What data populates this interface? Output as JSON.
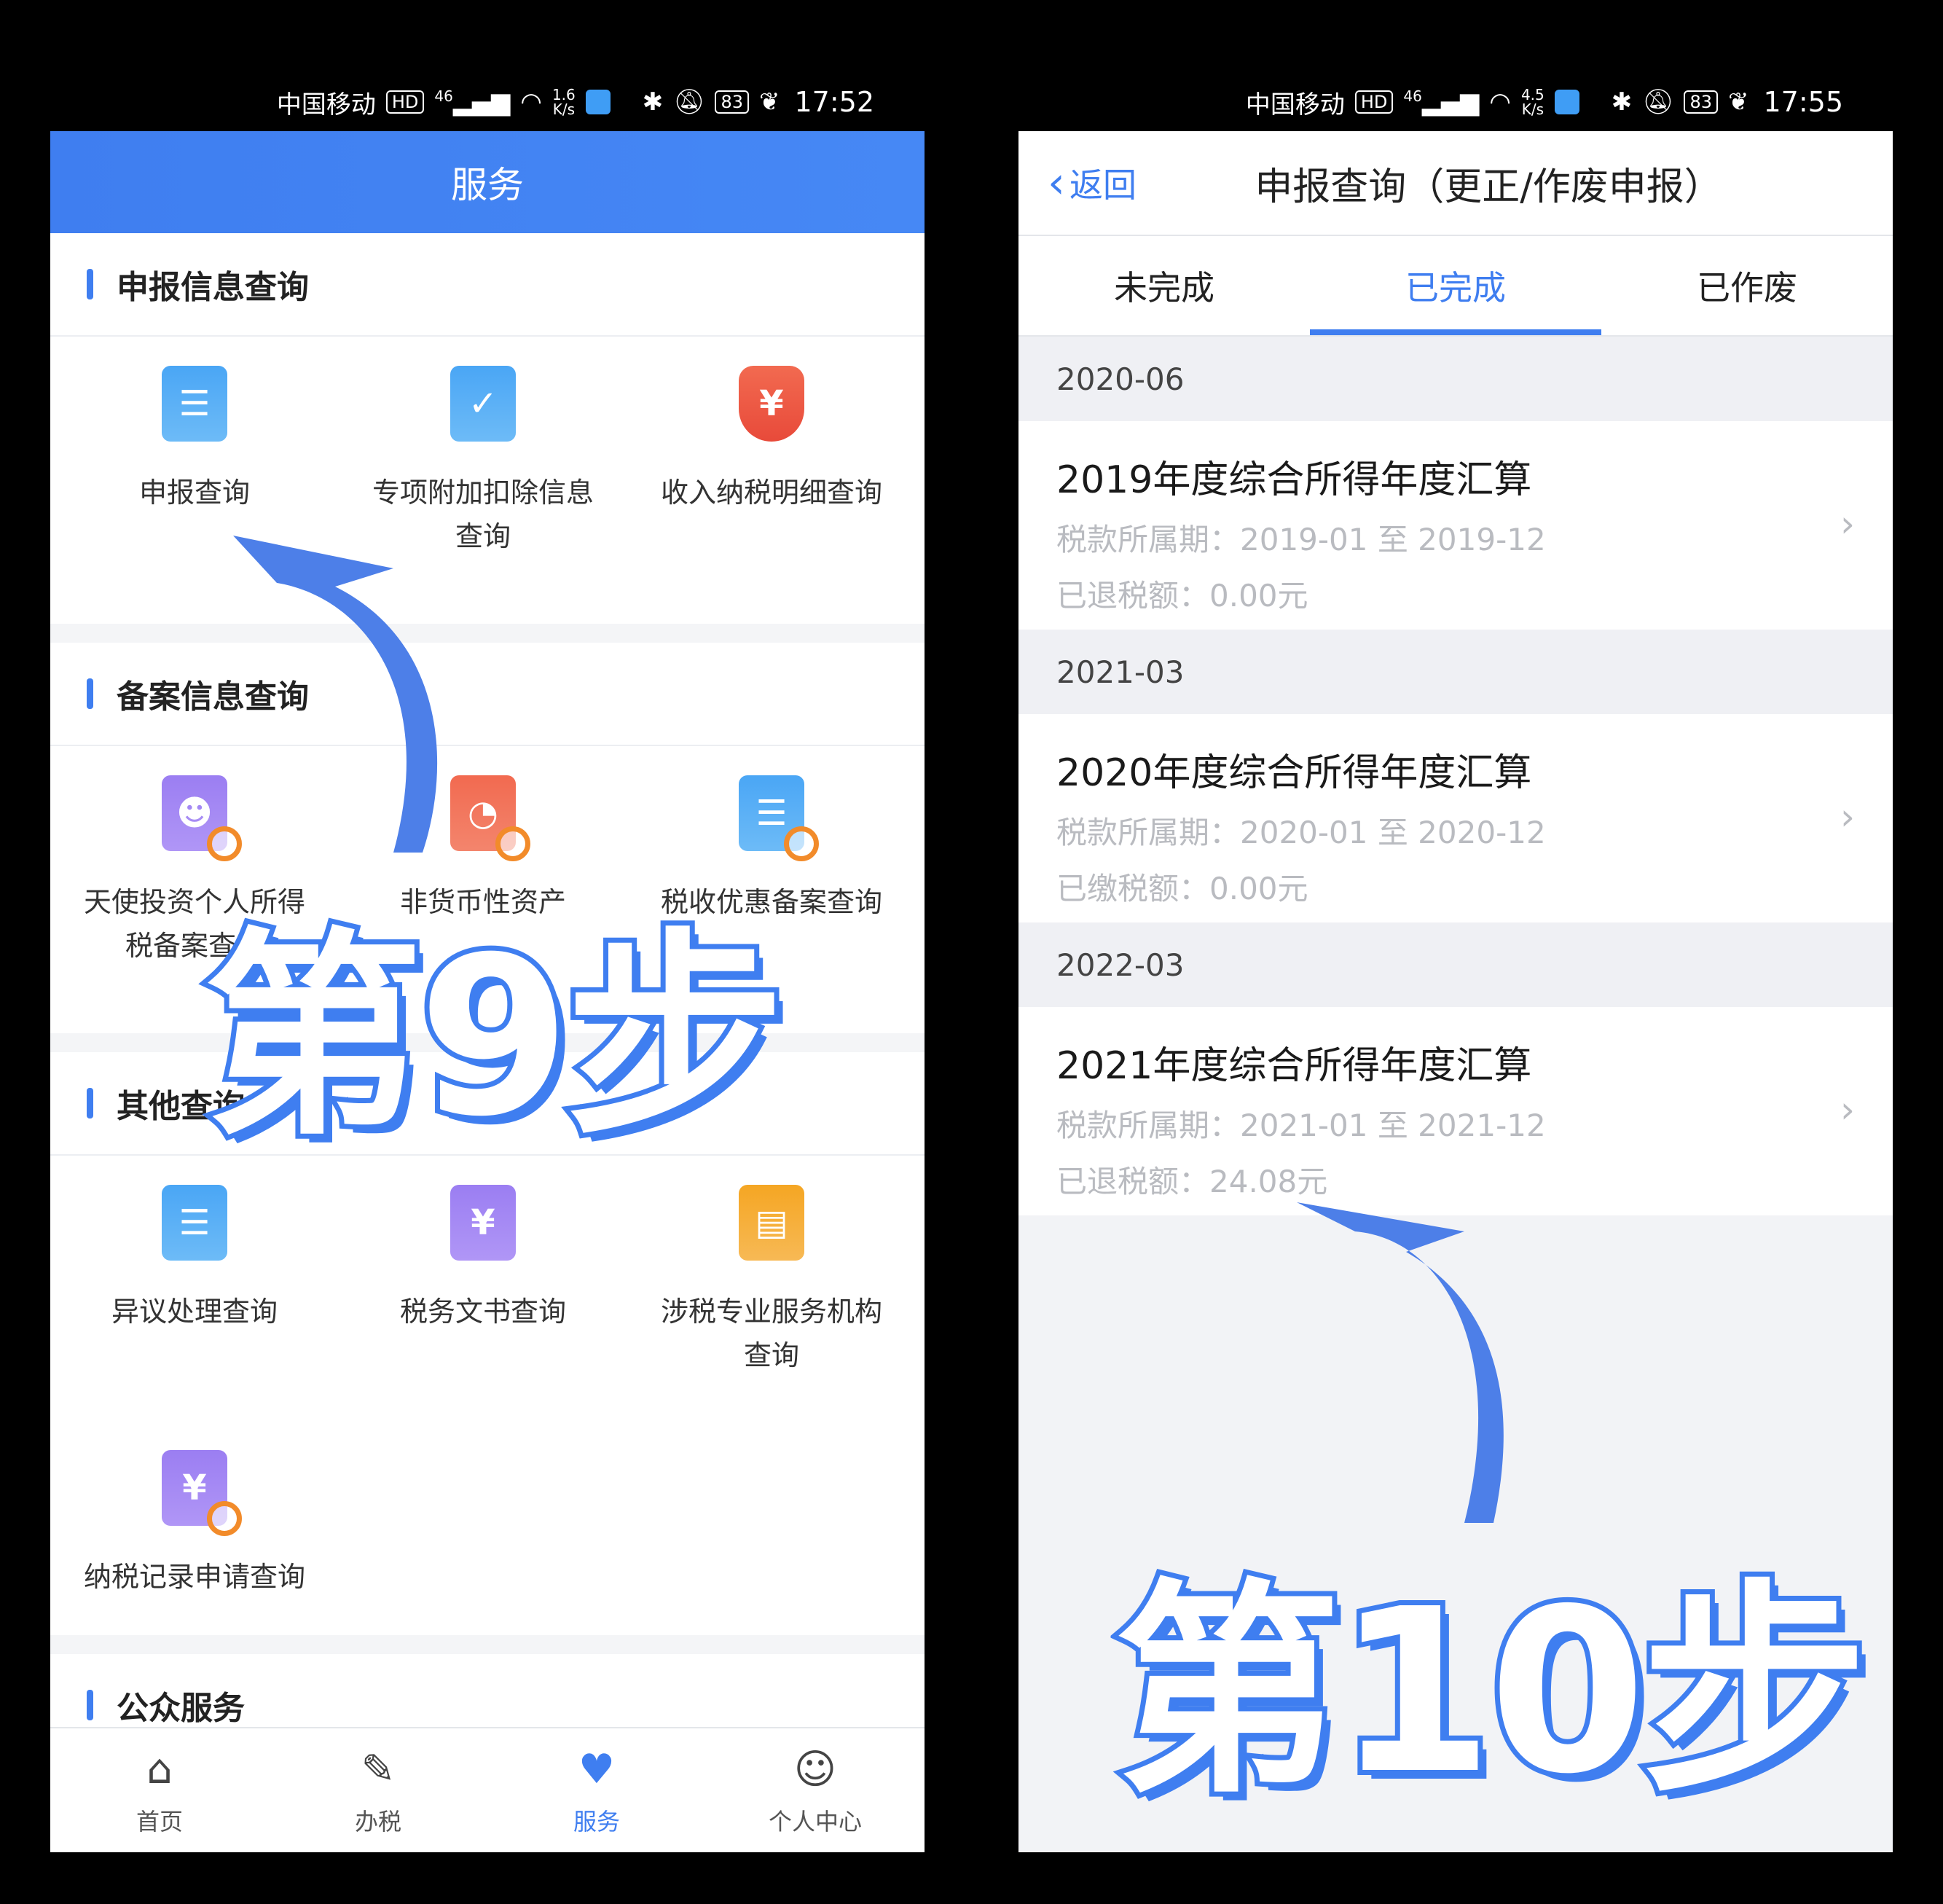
{
  "phone1": {
    "status": {
      "carrier": "中国移动",
      "hd": "HD",
      "net": "46",
      "speed_val": "1.6",
      "speed_unit": "K/s",
      "battery": "83",
      "time": "17:52"
    },
    "title": "服务",
    "sections": [
      {
        "title": "申报信息查询",
        "items": [
          "申报查询",
          "专项附加扣除信息查询",
          "收入纳税明细查询"
        ]
      },
      {
        "title": "备案信息查询",
        "items": [
          "天使投资个人所得税备案查询",
          "非货币性资产",
          "税收优惠备案查询"
        ]
      },
      {
        "title": "其他查询",
        "items": [
          "异议处理查询",
          "税务文书查询",
          "涉税专业服务机构查询",
          "纳税记录申请查询"
        ]
      },
      {
        "title": "公众服务"
      }
    ],
    "tabs": [
      {
        "label": "首页"
      },
      {
        "label": "办税"
      },
      {
        "label": "服务"
      },
      {
        "label": "个人中心"
      }
    ],
    "overlay": "第9步"
  },
  "phone2": {
    "status": {
      "carrier": "中国移动",
      "hd": "HD",
      "net": "46",
      "speed_val": "4.5",
      "speed_unit": "K/s",
      "battery": "83",
      "time": "17:55"
    },
    "back": "返回",
    "title": "申报查询（更正/作废申报）",
    "tabs": [
      "未完成",
      "已完成",
      "已作废"
    ],
    "groups": [
      {
        "date": "2020-06",
        "title": "2019年度综合所得年度汇算",
        "period": "税款所属期：2019-01 至 2019-12",
        "amount": "已退税额：0.00元"
      },
      {
        "date": "2021-03",
        "title": "2020年度综合所得年度汇算",
        "period": "税款所属期：2020-01 至 2020-12",
        "amount": "已缴税额：0.00元"
      },
      {
        "date": "2022-03",
        "title": "2021年度综合所得年度汇算",
        "period": "税款所属期：2021-01 至 2021-12",
        "amount": "已退税额：24.08元"
      }
    ],
    "overlay": "第10步"
  },
  "colors": {
    "accent": "#3f7ef0"
  }
}
